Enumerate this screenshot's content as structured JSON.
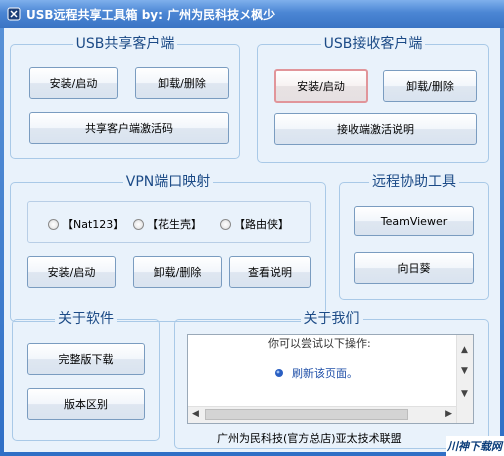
{
  "window": {
    "title": "USB远程共享工具箱 by: 广州为民科技メ枫少"
  },
  "usb_share_client": {
    "title": "USB共享客户端",
    "install_label": "安装/启动",
    "uninstall_label": "卸载/删除",
    "activation_label": "共享客户端激活码"
  },
  "usb_receive_client": {
    "title": "USB接收客户端",
    "install_label": "安装/启动",
    "uninstall_label": "卸载/删除",
    "activation_label": "接收端激活说明"
  },
  "vpn": {
    "title": "VPN端口映射",
    "options": [
      "【Nat123】",
      "【花生壳】",
      "【路由侠】"
    ],
    "install_label": "安装/启动",
    "uninstall_label": "卸载/删除",
    "help_label": "查看说明"
  },
  "remote_tools": {
    "title": "远程协助工具",
    "teamviewer_label": "TeamViewer",
    "sunflower_label": "向日葵"
  },
  "about_software": {
    "title": "关于软件",
    "download_label": "完整版下载",
    "versions_label": "版本区别"
  },
  "about_us": {
    "title": "关于我们",
    "web_line1": "你可以尝试以下操作:",
    "web_link": "刷新该页面。",
    "company": "广州为民科技(官方总店)亚太技术联盟"
  },
  "watermark": "川神下载网",
  "colors": {
    "titlebar": "#3a74c4",
    "client_bg": "#e9f2fb",
    "group_title": "#1b4a86",
    "link": "#1f4fa8"
  }
}
